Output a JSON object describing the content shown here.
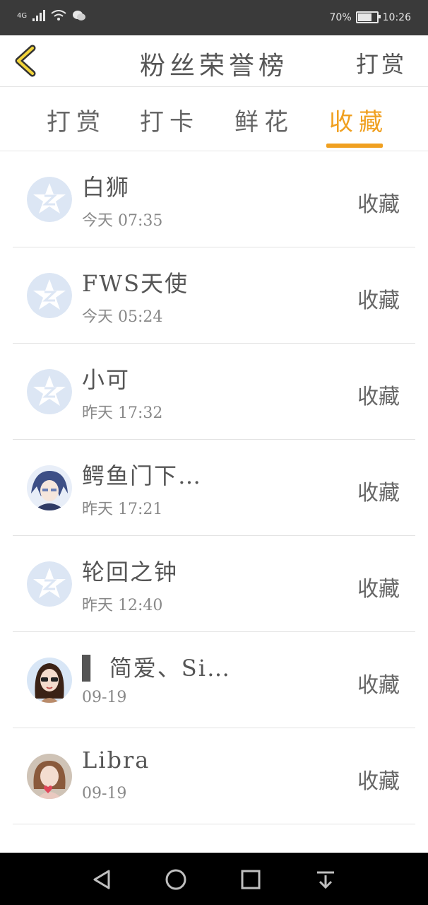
{
  "status_bar": {
    "network": "4G",
    "battery_percent": "70%",
    "battery_level": 0.7,
    "time": "10:26",
    "icons": [
      "signal-icon",
      "wifi-icon",
      "wechat-icon",
      "battery-icon"
    ]
  },
  "header": {
    "back_icon": "chevron-left-icon",
    "title": "粉丝荣誉榜",
    "action": "打赏"
  },
  "tabs": [
    {
      "label": "打赏",
      "active": false
    },
    {
      "label": "打卡",
      "active": false
    },
    {
      "label": "鲜花",
      "active": false
    },
    {
      "label": "收藏",
      "active": true
    }
  ],
  "accent_color": "#f0a020",
  "list": [
    {
      "name": "白狮",
      "time": "今天 07:35",
      "action": "收藏",
      "avatar": "default-avatar-icon"
    },
    {
      "name": "FWS天使",
      "time": "今天 05:24",
      "action": "收藏",
      "avatar": "default-avatar-icon"
    },
    {
      "name": "小可",
      "time": "昨天 17:32",
      "action": "收藏",
      "avatar": "default-avatar-icon"
    },
    {
      "name": "鳄鱼门下…",
      "time": "昨天 17:21",
      "action": "收藏",
      "avatar": "anime-avatar"
    },
    {
      "name": "轮回之钟",
      "time": "昨天 12:40",
      "action": "收藏",
      "avatar": "default-avatar-icon"
    },
    {
      "name": "▌ 简爱、Si…",
      "time": "09-19",
      "action": "收藏",
      "avatar": "girl-avatar"
    },
    {
      "name": "Libra",
      "time": "09-19",
      "action": "收藏",
      "avatar": "girl-avatar-2"
    }
  ],
  "nav_bar": {
    "icons": [
      "back-triangle-icon",
      "home-circle-icon",
      "recents-square-icon",
      "notification-pulldown-icon"
    ]
  }
}
